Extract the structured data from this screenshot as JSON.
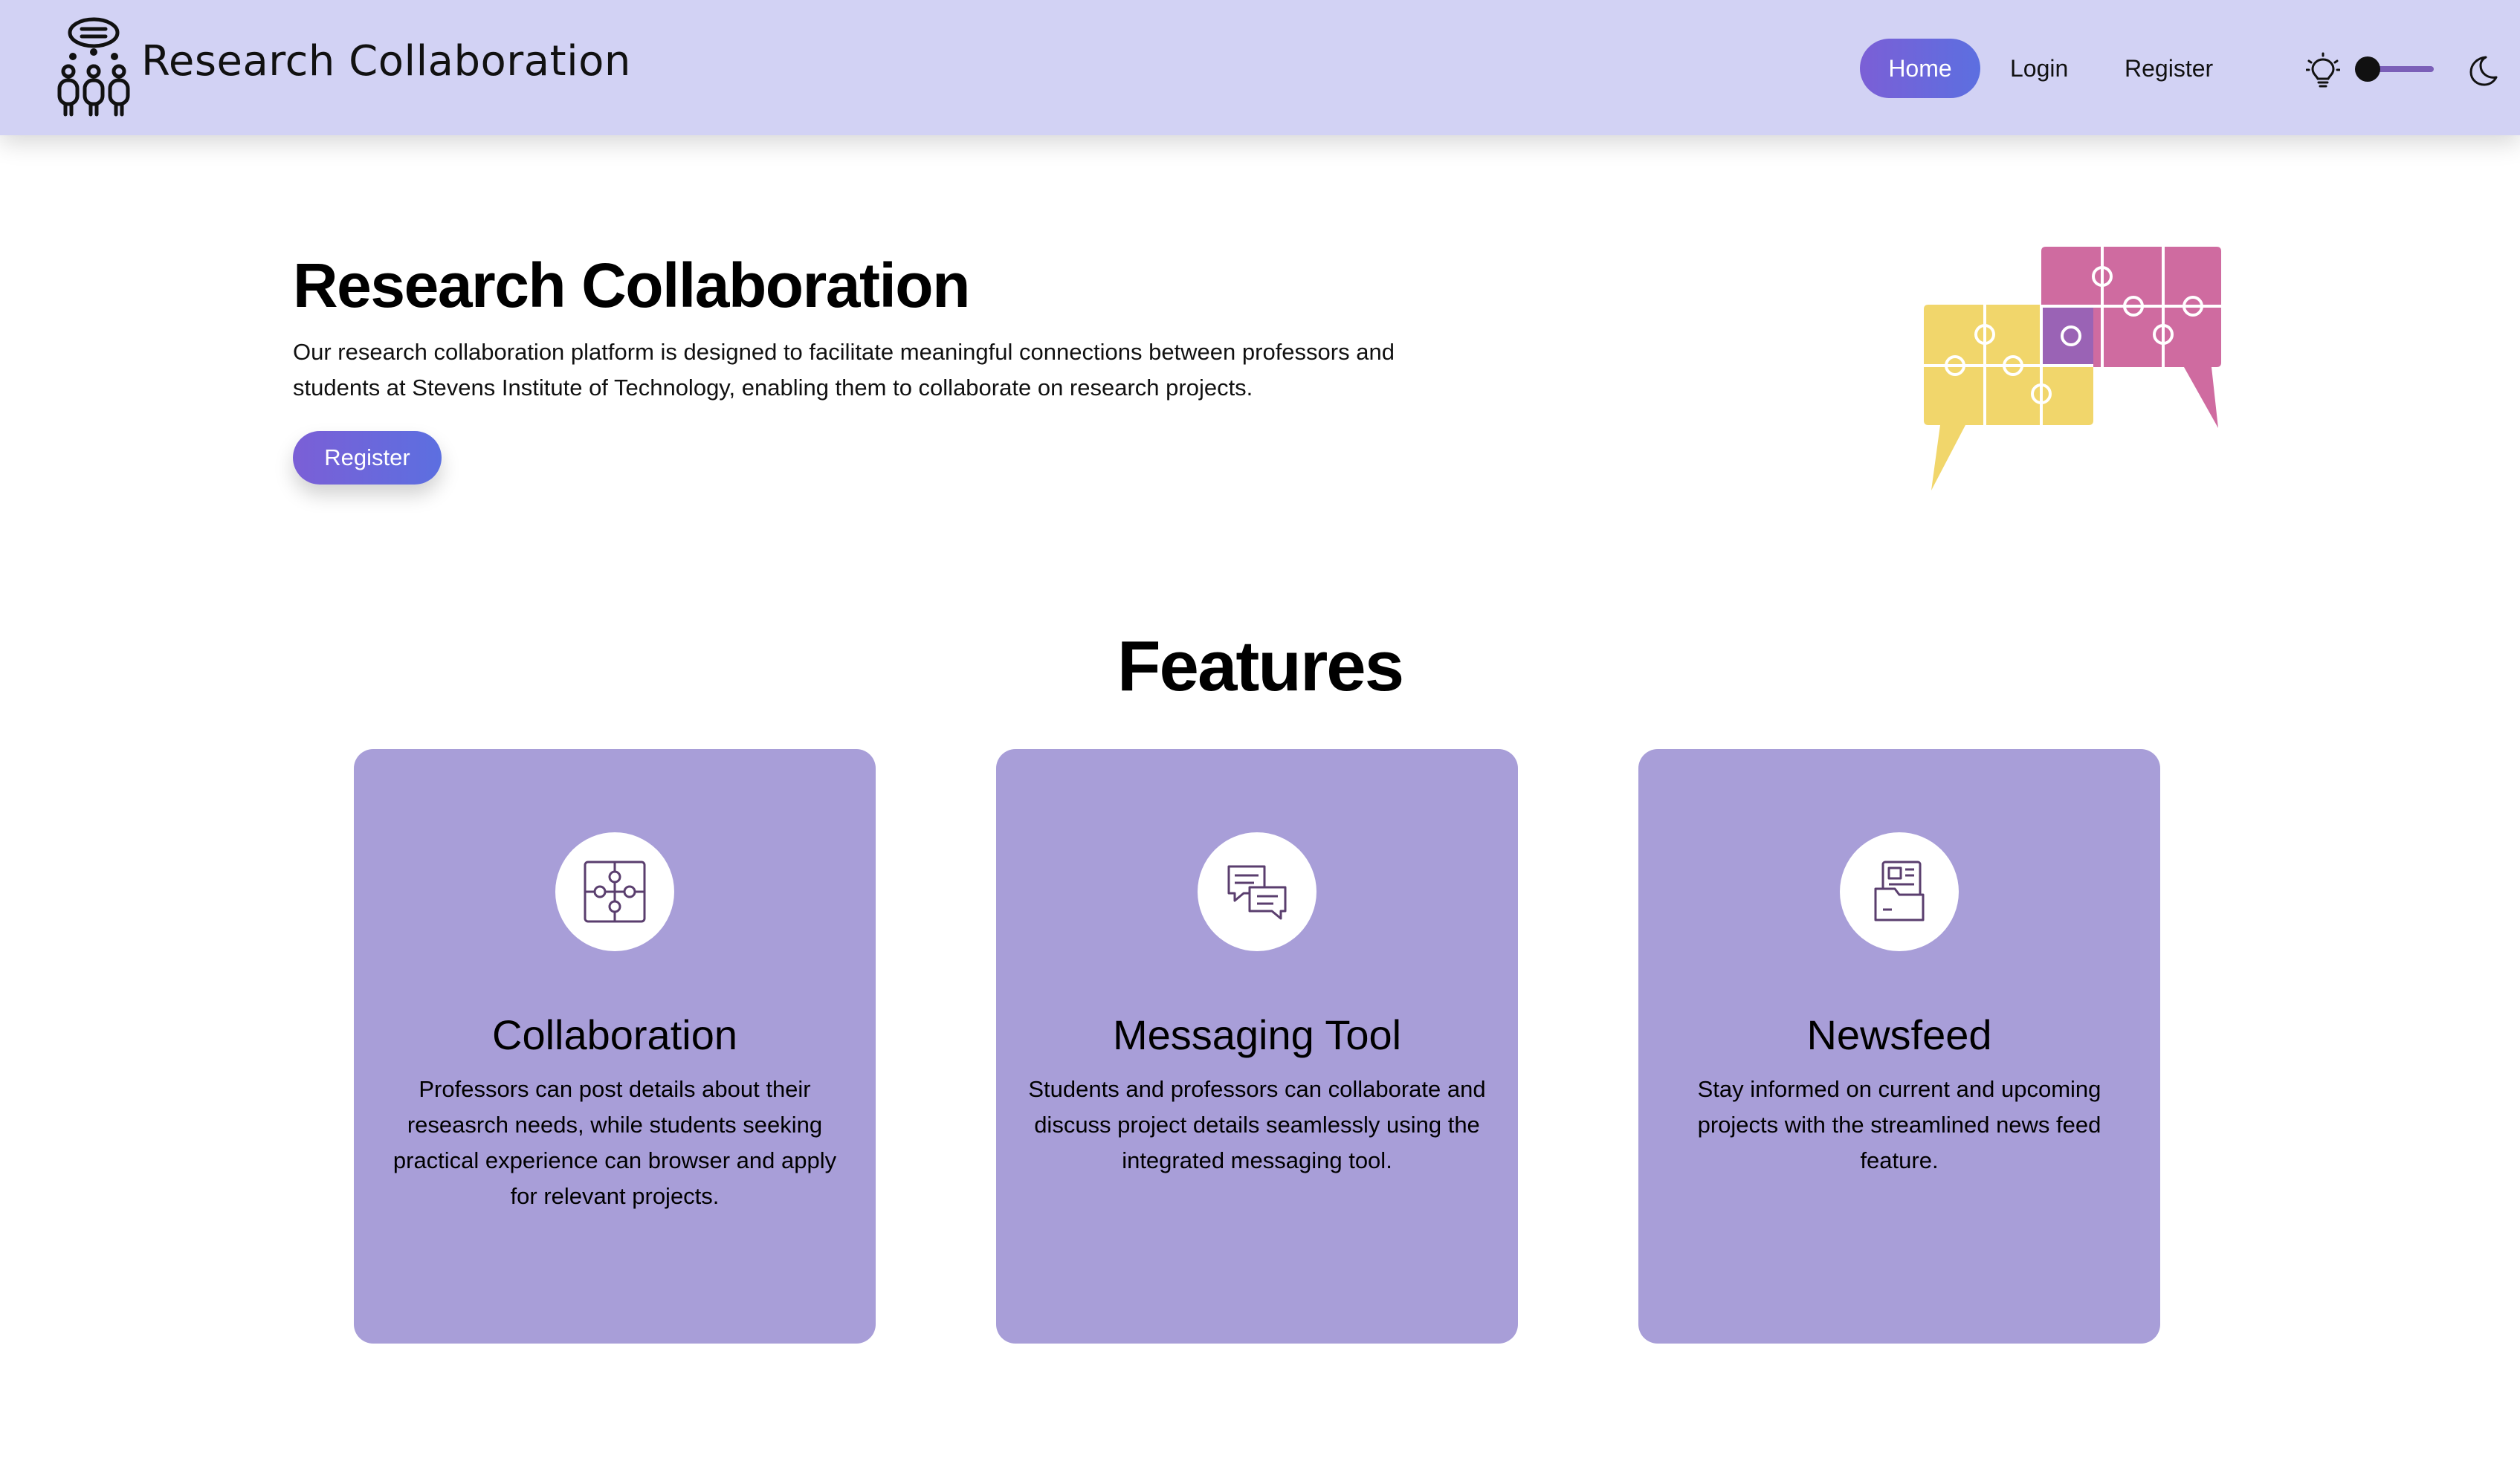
{
  "navbar": {
    "brand_title": "Research Collaboration",
    "links": {
      "home": "Home",
      "login": "Login",
      "register": "Register"
    },
    "active_link": "Home",
    "theme_toggle": {
      "left_icon": "lightbulb-icon",
      "right_icon": "moon-icon",
      "state": "light"
    }
  },
  "hero": {
    "title": "Research Collaboration",
    "description": "Our research collaboration platform is designed to facilitate meaningful connections between professors and students at Stevens Institute of Technology, enabling them to collaborate on research projects.",
    "register_button": "Register"
  },
  "features": {
    "title": "Features",
    "cards": [
      {
        "icon": "puzzle-icon",
        "title": "Collaboration",
        "text": "Professors can post details about their reseasrch needs, while students seeking practical experience can browser and apply for relevant projects."
      },
      {
        "icon": "chat-icon",
        "title": "Messaging Tool",
        "text": "Students and professors can collaborate and discuss project details seamlessly using the integrated messaging tool."
      },
      {
        "icon": "newsfeed-icon",
        "title": "Newsfeed",
        "text": "Stay informed on current and upcoming projects with the streamlined news feed feature."
      }
    ]
  },
  "colors": {
    "navbar_bg": "#d2d2f4",
    "accent_gradient_start": "#7b5fd6",
    "accent_gradient_end": "#5c6fe0",
    "card_bg": "#a89ed8",
    "icon_stroke": "#5a3e6e"
  }
}
